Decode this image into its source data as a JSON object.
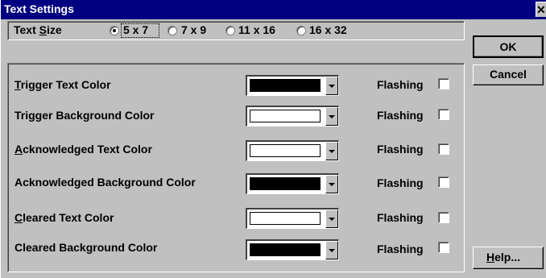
{
  "window": {
    "title": "Text Settings",
    "close_glyph": "✕"
  },
  "text_size": {
    "label_pre": "Text ",
    "label_mnemonic": "S",
    "label_post": "ize",
    "options": [
      {
        "label": "5 x 7",
        "selected": true
      },
      {
        "label": "7 x 9",
        "selected": false
      },
      {
        "label": "11 x 16",
        "selected": false
      },
      {
        "label": "16 x 32",
        "selected": false
      }
    ]
  },
  "buttons": {
    "ok": "OK",
    "cancel": "Cancel",
    "help_mnemonic": "H",
    "help_rest": "elp..."
  },
  "rows": [
    {
      "mnemonic": "T",
      "rest": "rigger Text Color",
      "color": "#000000",
      "flashing_label": "Flashing",
      "flashing": false
    },
    {
      "mnemonic": "",
      "rest": "Trigger Background Color",
      "color": "#ffffff",
      "flashing_label": "Flashing",
      "flashing": false
    },
    {
      "mnemonic": "A",
      "rest": "cknowledged Text Color",
      "color": "#ffffff",
      "flashing_label": "Flashing",
      "flashing": false
    },
    {
      "mnemonic": "",
      "rest": "Acknowledged Background Color",
      "color": "#000000",
      "flashing_label": "Flashing",
      "flashing": false
    },
    {
      "mnemonic": "C",
      "rest": "leared Text Color",
      "color": "#ffffff",
      "flashing_label": "Flashing",
      "flashing": false
    },
    {
      "mnemonic": "",
      "rest": "Cleared Background Color",
      "color": "#000000",
      "flashing_label": "Flashing",
      "flashing": false
    }
  ]
}
